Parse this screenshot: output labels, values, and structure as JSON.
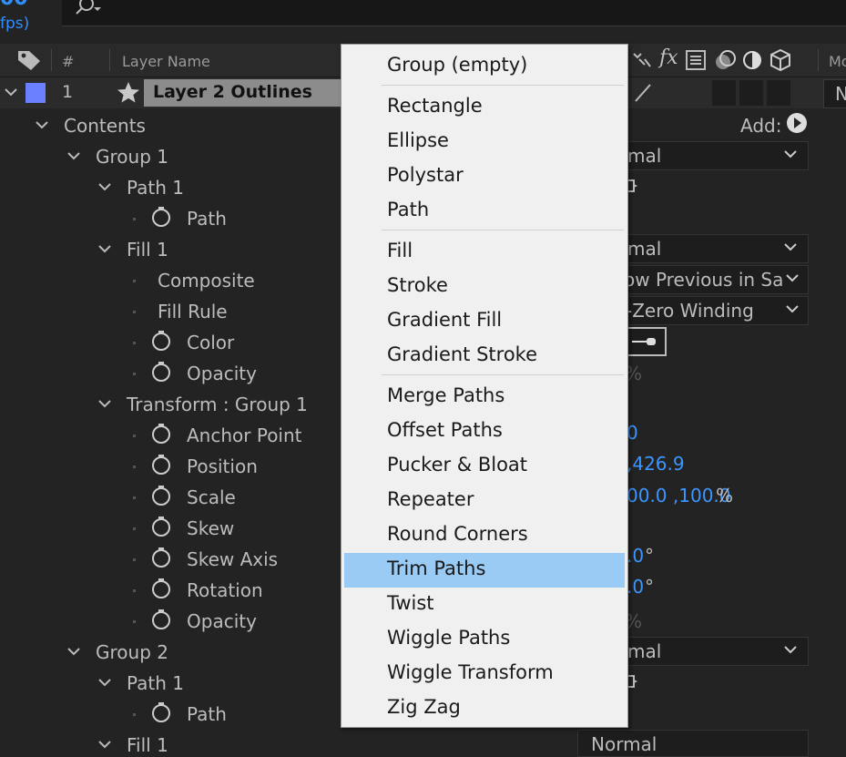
{
  "top": {
    "timecode": "00",
    "fps": "fps)"
  },
  "header": {
    "num": "#",
    "layer_name": "Layer Name",
    "mode_partial": "Mo",
    "fx": "fx"
  },
  "layer": {
    "index": "1",
    "name": "Layer 2 Outlines",
    "mode_partial": "N",
    "color": "#6b80ff"
  },
  "tree": {
    "contents": "Contents",
    "add_label": "Add:",
    "group1": "Group 1",
    "path1": "Path 1",
    "path": "Path",
    "fill1": "Fill 1",
    "composite": "Composite",
    "fill_rule": "Fill Rule",
    "color": "Color",
    "opacity": "Opacity",
    "transform_group1": "Transform : Group 1",
    "anchor_point": "Anchor Point",
    "position": "Position",
    "scale": "Scale",
    "skew": "Skew",
    "skew_axis": "Skew Axis",
    "rotation": "Rotation",
    "opacity2": "Opacity",
    "group2": "Group 2",
    "path1_b": "Path 1",
    "path_b": "Path",
    "fill1_b": "Fill 1"
  },
  "values": {
    "group1_mode": "mal",
    "fill_mode": "mal",
    "composite_value": "ow Previous in Sa",
    "fill_rule_value": "-Zero Winding",
    "opacity_pct": "%",
    "anchor_value": "0",
    "position_value": ",426.9",
    "scale_value": "00.0 ,100.0",
    "scale_unit": "%",
    "skew_value": ".0",
    "skew_unit": "°",
    "rotation_value": ".0",
    "rotation_unit": "°",
    "opacity2_pct": "%",
    "group2_mode": "mal",
    "fill1b_mode": "Normal"
  },
  "menu": {
    "items": [
      "Group (empty)",
      "Rectangle",
      "Ellipse",
      "Polystar",
      "Path",
      "Fill",
      "Stroke",
      "Gradient Fill",
      "Gradient Stroke",
      "Merge Paths",
      "Offset Paths",
      "Pucker & Bloat",
      "Repeater",
      "Round Corners",
      "Trim Paths",
      "Twist",
      "Wiggle Paths",
      "Wiggle Transform",
      "Zig Zag"
    ],
    "highlighted": "Trim Paths"
  },
  "colors": {
    "accent": "#3b95ff",
    "highlight": "#99cbf5",
    "label": "#6b80ff"
  }
}
